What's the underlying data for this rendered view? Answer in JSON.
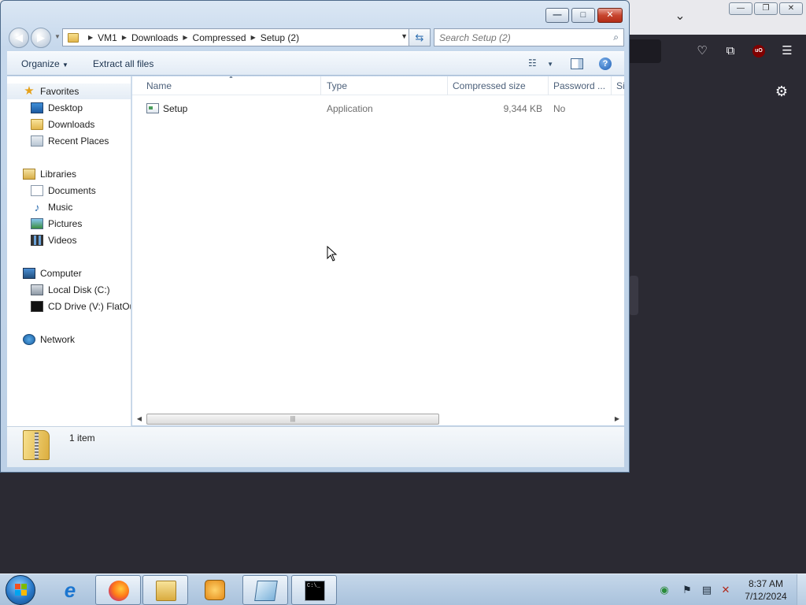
{
  "explorer": {
    "breadcrumb": [
      "VM1",
      "Downloads",
      "Compressed",
      "Setup (2)"
    ],
    "search": {
      "placeholder": "Search Setup (2)"
    },
    "title_controls": {
      "minimize": "—",
      "maximize": "□",
      "close": "✕"
    },
    "toolbar": {
      "organize_label": "Organize",
      "extract_label": "Extract all files"
    },
    "nav_pane": {
      "favorites": {
        "label": "Favorites",
        "items": [
          "Desktop",
          "Downloads",
          "Recent Places"
        ]
      },
      "libraries": {
        "label": "Libraries",
        "items": [
          "Documents",
          "Music",
          "Pictures",
          "Videos"
        ]
      },
      "computer": {
        "label": "Computer",
        "items": [
          "Local Disk (C:)",
          "CD Drive (V:) FlatOut"
        ]
      },
      "network": {
        "label": "Network"
      }
    },
    "columns": [
      "Name",
      "Type",
      "Compressed size",
      "Password ...",
      "Si"
    ],
    "files": [
      {
        "name": "Setup",
        "type": "Application",
        "compressed_size": "9,344 KB",
        "password": "No"
      }
    ],
    "details": {
      "item_count": "1 item"
    }
  },
  "taskbar": {
    "clock": {
      "time": "8:37 AM",
      "date": "7/12/2024"
    },
    "cmd_glyph": "C:\\_"
  },
  "colors": {
    "window_frame": "#c6d8ec",
    "taskbar": "#b3cae2",
    "browser_bg": "#2b2a33",
    "close_button": "#c7452f"
  }
}
